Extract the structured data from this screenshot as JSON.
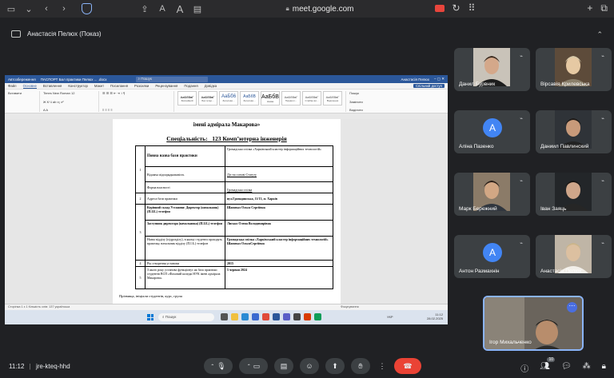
{
  "browser": {
    "url": "meet.google.com",
    "lock_icon": "lock-icon",
    "aa_label": "A",
    "aa_label2": "A"
  },
  "presenter": {
    "label": "Анастасія Пелюх (Показ)"
  },
  "word": {
    "autosave": "Автозбереження",
    "doc_name": "ПАСПОРТ Бал практики Пелюх ... .docx",
    "search": "Пошук",
    "user": "Анастасія Пелюх",
    "tabs": [
      "Файл",
      "Основне",
      "Вставлення",
      "Конструктор",
      "Макет",
      "Посилання",
      "Розсилки",
      "Рецензування",
      "Подання",
      "Довідка"
    ],
    "share": "Спільний доступ",
    "font": "Times New Roman",
    "size": "12",
    "styles": [
      {
        "sample": "АаБбВвГ",
        "name": "Звичайний"
      },
      {
        "sample": "АаБбВвГ",
        "name": "Без інтер..."
      },
      {
        "sample": "АаБб6",
        "name": "Заголово..."
      },
      {
        "sample": "АаБбВ",
        "name": "Заголово..."
      },
      {
        "sample": "АаБбВ",
        "name": "Назва"
      },
      {
        "sample": "АаБбВвГ",
        "name": "Підзагол..."
      },
      {
        "sample": "АаБбВвГ",
        "name": "Слабке ви..."
      },
      {
        "sample": "АаБбВвГ",
        "name": "Виділення"
      }
    ],
    "ribbon_find": "Пошук",
    "ribbon_replace": "Замінити",
    "ribbon_select": "Виділити",
    "paste": "Вставити",
    "status": "Сторінка 1 з 1  Кількість слів: 137  українська",
    "focus": "Фокусування"
  },
  "doc": {
    "heading": "імені адмірала Макарова»",
    "spec_prefix": "Спеціальність:",
    "spec_value": "123 Комп’ютерна інженерія",
    "rows": [
      {
        "num": "1",
        "label": "Повна назва бази практики",
        "value": "Громадська спілка «Харківський кластер інформаційних технологій»"
      },
      {
        "num": "",
        "label": "Відомча підпорядкованість",
        "value": "Діє на основі Статуту"
      },
      {
        "num": "",
        "label": "Форма власності",
        "value": "Громадська спілка"
      },
      {
        "num": "2",
        "label": "Адреса бази практики",
        "value": "вул.Гропадянська, 11/13, м. Харків"
      },
      {
        "num": "",
        "label": "Керівний склад Установи: Директор (начальник) (П.І.Б.) телефон",
        "value": "Шаповал Ольга Сергіївна"
      },
      {
        "num": "3",
        "label": "Заступник директора (начальника) (П.І.Б.) телефон",
        "value": "Лисько Олена Володимирівна"
      },
      {
        "num": "",
        "label": "Назва відділу (підрозділу), в якому студенти проходять практику, начальник відділу (П.І.Б.) телефон",
        "value": "Громадська спілка «Харківський кластер інформаційних технологій» Шаповал ОльгаСергіївна"
      },
      {
        "num": "4",
        "label": "Рік створення установи",
        "value": "2015"
      },
      {
        "num": "5",
        "label": "З якого року установа функціонує як база практики студентів ВСП «Фаховий коледж НУК імені адмірала Макарова»",
        "value": "5 червня 2024"
      }
    ],
    "footer": "Прізвища, ініціали студентів, курс, група"
  },
  "taskbar": {
    "search": "Пошук",
    "lang": "УКР",
    "time": "11:12",
    "date": "28.02.2025"
  },
  "participants": [
    {
      "name": "Данил Бурвник",
      "type": "video"
    },
    {
      "name": "Вірсавія Крилевська",
      "type": "video"
    },
    {
      "name": "Аліна Пазенко",
      "type": "avatar",
      "initial": "A"
    },
    {
      "name": "Даниил Павлинский",
      "type": "video"
    },
    {
      "name": "Марк Бережний",
      "type": "video"
    },
    {
      "name": "Іван Заяць",
      "type": "video"
    },
    {
      "name": "Антон Размахнін",
      "type": "avatar",
      "initial": "A"
    },
    {
      "name": "Анастасія Пелюх",
      "type": "video"
    }
  ],
  "self": {
    "name": "Ігор Михальченко",
    "more": "⋯"
  },
  "meeting": {
    "time": "11:12",
    "code": "jre-kteq-hhd",
    "participants_count": "10"
  },
  "colors": {
    "end_call": "#ea4335",
    "avatar": "#4285f4",
    "word_blue": "#2b579a"
  }
}
